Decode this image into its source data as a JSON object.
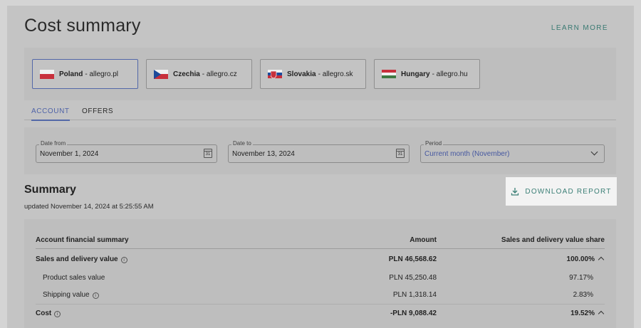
{
  "header": {
    "title": "Cost summary",
    "learn_more": "LEARN MORE"
  },
  "markets": [
    {
      "country": "Poland",
      "site": "- allegro.pl",
      "flag": "poland-flag-icon",
      "active": true
    },
    {
      "country": "Czechia",
      "site": "- allegro.cz",
      "flag": "czechia-flag-icon",
      "active": false
    },
    {
      "country": "Slovakia",
      "site": "- allegro.sk",
      "flag": "slovakia-flag-icon",
      "active": false
    },
    {
      "country": "Hungary",
      "site": "- allegro.hu",
      "flag": "hungary-flag-icon",
      "active": false
    }
  ],
  "tabs": [
    {
      "label": "ACCOUNT",
      "active": true
    },
    {
      "label": "OFFERS",
      "active": false
    }
  ],
  "filters": {
    "date_from": {
      "label": "Date from",
      "value": "November 1, 2024",
      "icon": "calendar-icon",
      "icon_text": "31"
    },
    "date_to": {
      "label": "Date to",
      "value": "November 13, 2024",
      "icon": "calendar-icon",
      "icon_text": "31"
    },
    "period": {
      "label": "Period",
      "value": "Current month (November)",
      "icon": "chevron-down-icon"
    }
  },
  "summary": {
    "title": "Summary",
    "updated": "updated November 14, 2024 at 5:25:55 AM",
    "download_label": "DOWNLOAD REPORT"
  },
  "table": {
    "headers": [
      "Account financial summary",
      "Amount",
      "Sales and delivery value share"
    ],
    "rows": [
      {
        "label": "Sales and delivery value",
        "amount": "PLN 46,568.62",
        "share": "100.00%"
      },
      {
        "label": "Product sales value",
        "amount": "PLN 45,250.48",
        "share": "97.17%"
      },
      {
        "label": "Shipping value",
        "amount": "PLN 1,318.14",
        "share": "2.83%"
      },
      {
        "label": "Cost",
        "amount": "-PLN 9,088.42",
        "share": "19.52%"
      }
    ]
  },
  "colors": {
    "accent_teal": "#3b7f76",
    "accent_blue": "#5368a8",
    "download_bg": "#f3f3f3"
  }
}
